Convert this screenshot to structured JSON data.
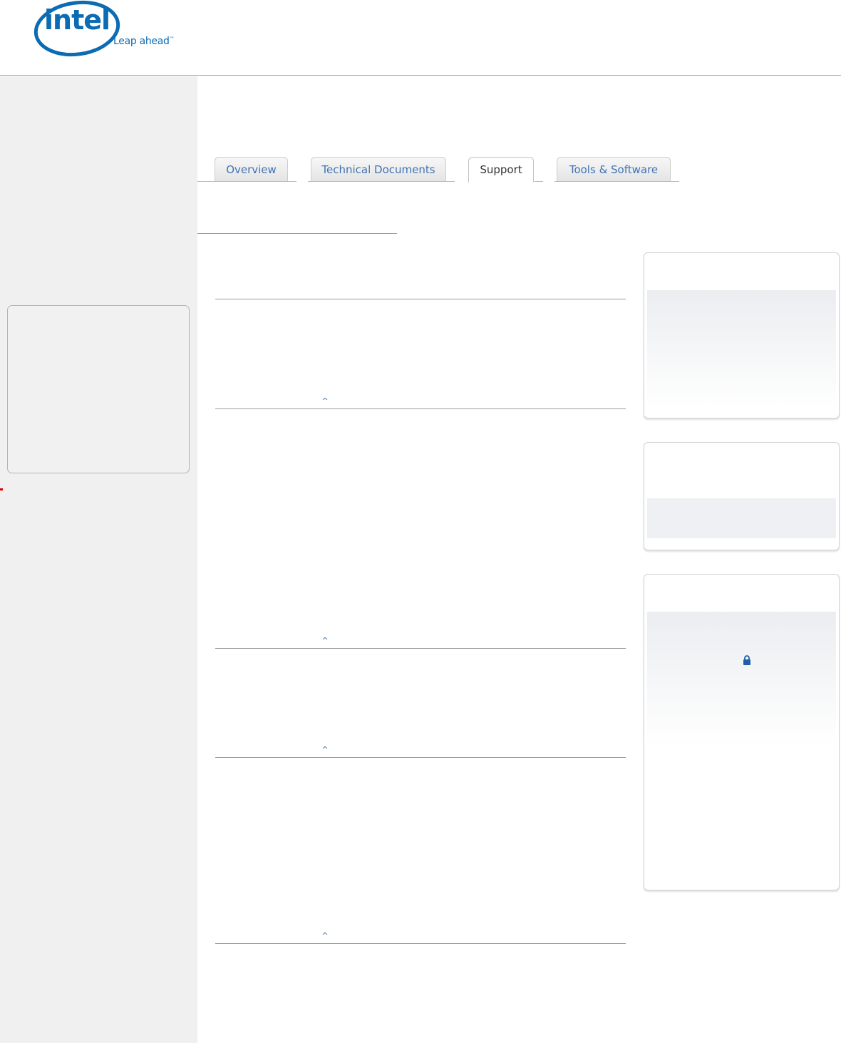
{
  "brand": {
    "logo_word": "intel",
    "logo_tagline": "Leap ahead",
    "logo_tagline_mark": "™",
    "brand_color": "#0b6bb3"
  },
  "tabs": [
    {
      "label": "Overview",
      "active": false
    },
    {
      "label": "Technical Documents",
      "active": false
    },
    {
      "label": "Support",
      "active": true
    },
    {
      "label": "Tools & Software",
      "active": false
    }
  ],
  "back_to_top_glyph": "^",
  "icons": {
    "lock": "lock-icon"
  },
  "colors": {
    "link": "#3f74b4",
    "sidebar_bg": "#f0f0f0",
    "rule": "#9a9a9a"
  }
}
